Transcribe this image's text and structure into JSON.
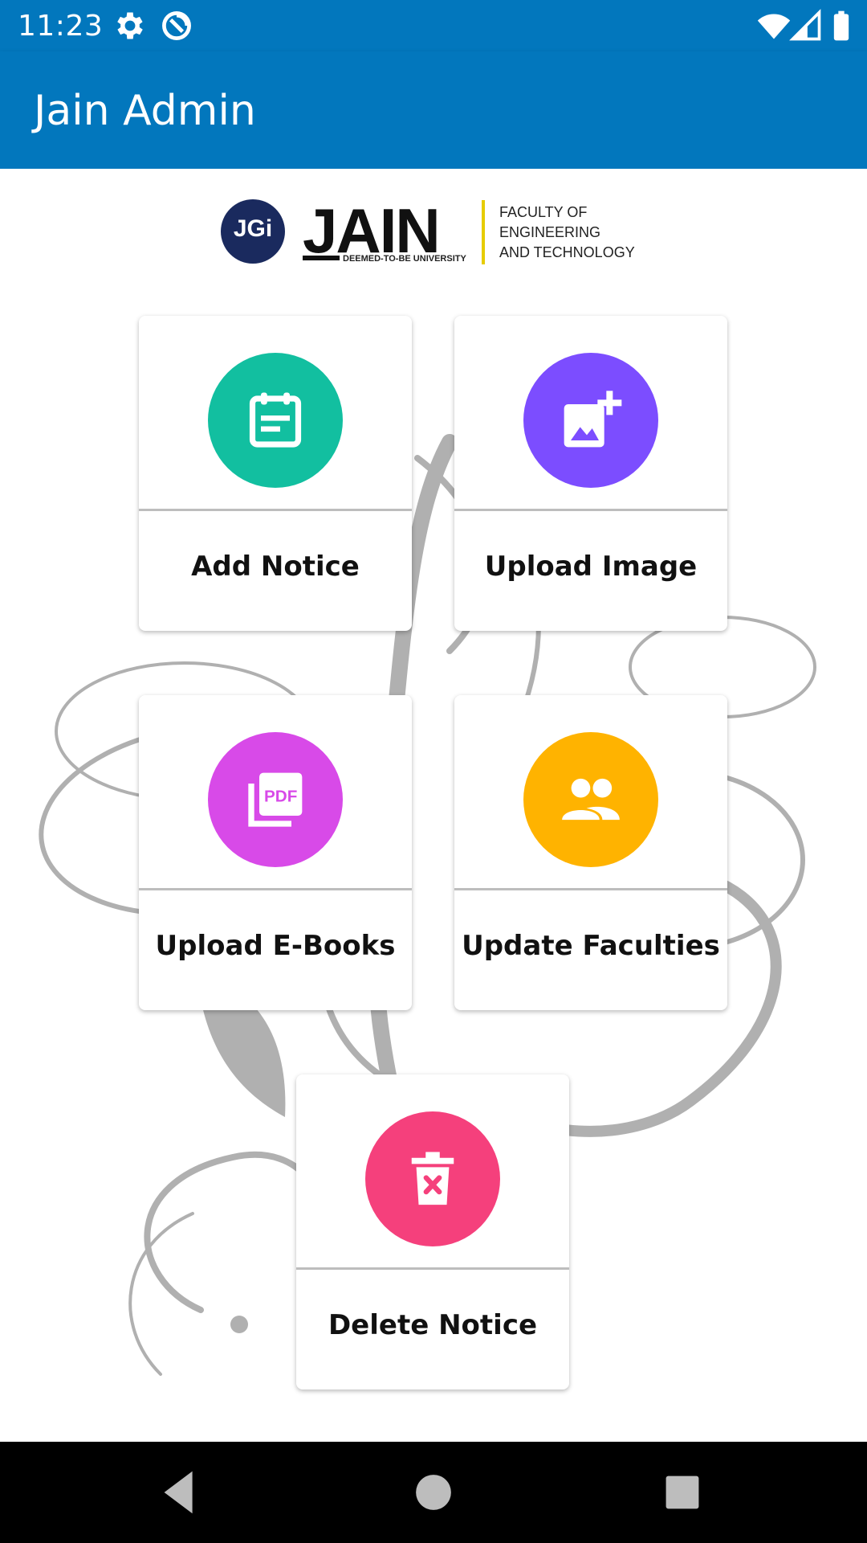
{
  "status": {
    "time": "11:23",
    "icons": [
      "settings-icon",
      "data-saver-icon",
      "wifi-icon",
      "signal-icon",
      "battery-icon"
    ]
  },
  "appbar": {
    "title": "Jain Admin",
    "color": "#0277bd"
  },
  "logo": {
    "badge": "JGi",
    "wordmark": "JAIN",
    "tagline": "DEEMED-TO-BE UNIVERSITY",
    "faculty_line1": "FACULTY OF",
    "faculty_line2": "ENGINEERING",
    "faculty_line3": "AND TECHNOLOGY"
  },
  "cards": [
    {
      "label": "Add Notice",
      "icon": "notice-icon",
      "color": "#12bfa0"
    },
    {
      "label": "Upload Image",
      "icon": "add-image-icon",
      "color": "#7c4dff"
    },
    {
      "label": "Upload E-Books",
      "icon": "pdf-icon",
      "color": "#d84ae8"
    },
    {
      "label": "Update Faculties",
      "icon": "people-icon",
      "color": "#ffb300"
    },
    {
      "label": "Delete Notice",
      "icon": "delete-icon",
      "color": "#f5407c"
    }
  ],
  "navbar": {
    "buttons": [
      "back-icon",
      "home-icon",
      "recents-icon"
    ]
  }
}
